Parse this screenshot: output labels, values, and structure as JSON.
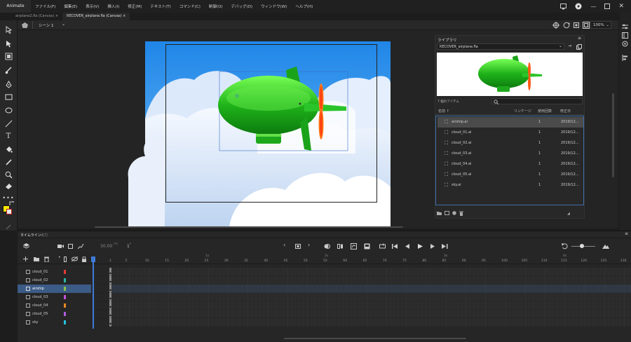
{
  "app_name": "Animate",
  "menu": [
    "ファイル(F)",
    "編集(E)",
    "表示(V)",
    "挿入(I)",
    "修正(M)",
    "テキスト(T)",
    "コマンド(C)",
    "制御(O)",
    "デバッグ(D)",
    "ウィンドウ(W)",
    "ヘルプ(H)"
  ],
  "tabs": [
    {
      "label": "airplane2.fla (Canvas)",
      "close": "×",
      "active": false
    },
    {
      "label": "RECOVER_airplane.fla (Canvas)",
      "close": "×",
      "active": true
    }
  ],
  "scene_label": "シーン 1",
  "zoom": "100%",
  "library": {
    "title": "ライブラリ",
    "file": "RECOVER_airplane.fla",
    "item_count": "7 個のアイテム",
    "columns": [
      "名前 ↑",
      "リンケージ",
      "使用回数",
      "修正日"
    ],
    "items": [
      {
        "name": "airship.ai",
        "uses": "1",
        "date": "2019/12..."
      },
      {
        "name": "cloud_01.ai",
        "uses": "1",
        "date": "2019/12..."
      },
      {
        "name": "cloud_02.ai",
        "uses": "1",
        "date": "2019/12..."
      },
      {
        "name": "cloud_03.ai",
        "uses": "1",
        "date": "2019/12..."
      },
      {
        "name": "cloud_04.ai",
        "uses": "1",
        "date": "2019/12..."
      },
      {
        "name": "cloud_05.ai",
        "uses": "1",
        "date": "2019/12..."
      },
      {
        "name": "sky.ai",
        "uses": "1",
        "date": "2019/12..."
      }
    ],
    "selected_index": 0
  },
  "timeline": {
    "tab": "タイムライン",
    "tab2": "出力",
    "fps": "30.00",
    "fps_unit": "FPS",
    "frame": "1",
    "frame_unit": "F",
    "second_marks": [
      "1s",
      "2s",
      "3s",
      "4s"
    ],
    "frame_numbers": [
      "1",
      "5",
      "10",
      "15",
      "20",
      "25",
      "30",
      "35",
      "40",
      "45",
      "50",
      "55",
      "60",
      "65",
      "70",
      "75",
      "80",
      "85",
      "90",
      "95",
      "100",
      "105",
      "110",
      "115",
      "120",
      "125",
      "130"
    ],
    "layers": [
      {
        "name": "cloud_01",
        "color": "#e53935"
      },
      {
        "name": "cloud_02",
        "color": "#2bb5a6"
      },
      {
        "name": "airship",
        "color": "#8bc34a"
      },
      {
        "name": "cloud_03",
        "color": "#c64fd9"
      },
      {
        "name": "cloud_04",
        "color": "#f08a24"
      },
      {
        "name": "cloud_05",
        "color": "#b05ce0"
      },
      {
        "name": "sky",
        "color": "#27c0e0"
      }
    ],
    "selected_layer": 2
  }
}
